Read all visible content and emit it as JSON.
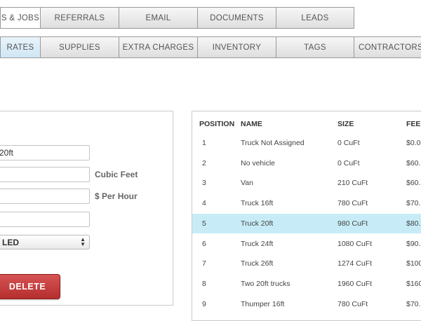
{
  "tabs_top": [
    {
      "label": "S & JOBS",
      "state": "active"
    },
    {
      "label": "REFERRALS"
    },
    {
      "label": "EMAIL"
    },
    {
      "label": "DOCUMENTS"
    },
    {
      "label": "LEADS"
    }
  ],
  "tabs_second": [
    {
      "label": "RATES",
      "state": "active"
    },
    {
      "label": "SUPPLIES"
    },
    {
      "label": "EXTRA CHARGES"
    },
    {
      "label": "INVENTORY"
    },
    {
      "label": "TAGS"
    },
    {
      "label": "CONTRACTORS"
    }
  ],
  "form": {
    "name_value": "20ft",
    "cubic_value": "",
    "cubic_unit": "Cubic Feet",
    "rate_value": "",
    "rate_unit": "$ Per Hour",
    "extra_value": "",
    "status_selected": "LED",
    "delete_label": "DELETE"
  },
  "table": {
    "headers": {
      "position": "POSITION",
      "name": "NAME",
      "size": "SIZE",
      "fee": "FEE"
    },
    "rows": [
      {
        "position": "1",
        "name": "Truck Not Assigned",
        "size": "0 CuFt",
        "fee": "$0.0"
      },
      {
        "position": "2",
        "name": "No vehicle",
        "size": "0 CuFt",
        "fee": "$60."
      },
      {
        "position": "3",
        "name": "Van",
        "size": "210 CuFt",
        "fee": "$60."
      },
      {
        "position": "4",
        "name": "Truck 16ft",
        "size": "780 CuFt",
        "fee": "$70."
      },
      {
        "position": "5",
        "name": "Truck 20ft",
        "size": "980 CuFt",
        "fee": "$80."
      },
      {
        "position": "6",
        "name": "Truck 24ft",
        "size": "1080 CuFt",
        "fee": "$90."
      },
      {
        "position": "7",
        "name": "Truck 26ft",
        "size": "1274 CuFt",
        "fee": "$100"
      },
      {
        "position": "8",
        "name": "Two 20ft trucks",
        "size": "1960 CuFt",
        "fee": "$160"
      },
      {
        "position": "9",
        "name": "Thumper 16ft",
        "size": "780 CuFt",
        "fee": "$70."
      }
    ]
  },
  "colors": {
    "selected_row": "#c7ecf7",
    "delete_button": "#c04040",
    "active_tab": "#d8ecf8"
  }
}
